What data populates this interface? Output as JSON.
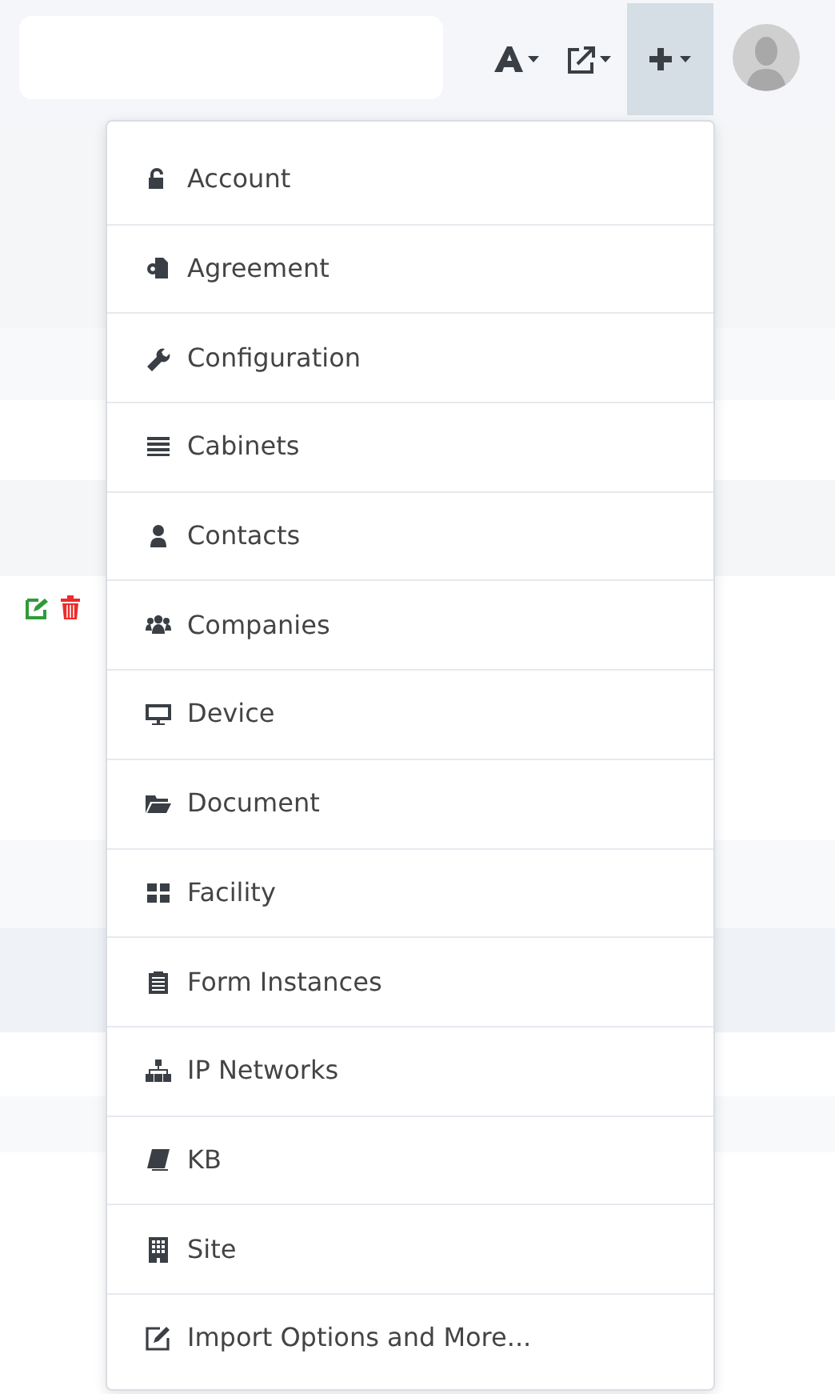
{
  "toolbar": {
    "buttons": [
      {
        "selected": false
      },
      {
        "selected": false
      },
      {
        "selected": true
      }
    ]
  },
  "add_menu": {
    "expanded": true,
    "items": [
      {
        "label": "Account"
      },
      {
        "label": "Agreement"
      },
      {
        "label": "Configuration"
      },
      {
        "label": "Cabinets"
      },
      {
        "label": "Contacts"
      },
      {
        "label": "Companies"
      },
      {
        "label": "Device"
      },
      {
        "label": "Document"
      },
      {
        "label": "Facility"
      },
      {
        "label": "Form Instances"
      },
      {
        "label": "IP Networks"
      },
      {
        "label": "KB"
      },
      {
        "label": "Site"
      },
      {
        "label": "Import Options and More..."
      }
    ]
  }
}
